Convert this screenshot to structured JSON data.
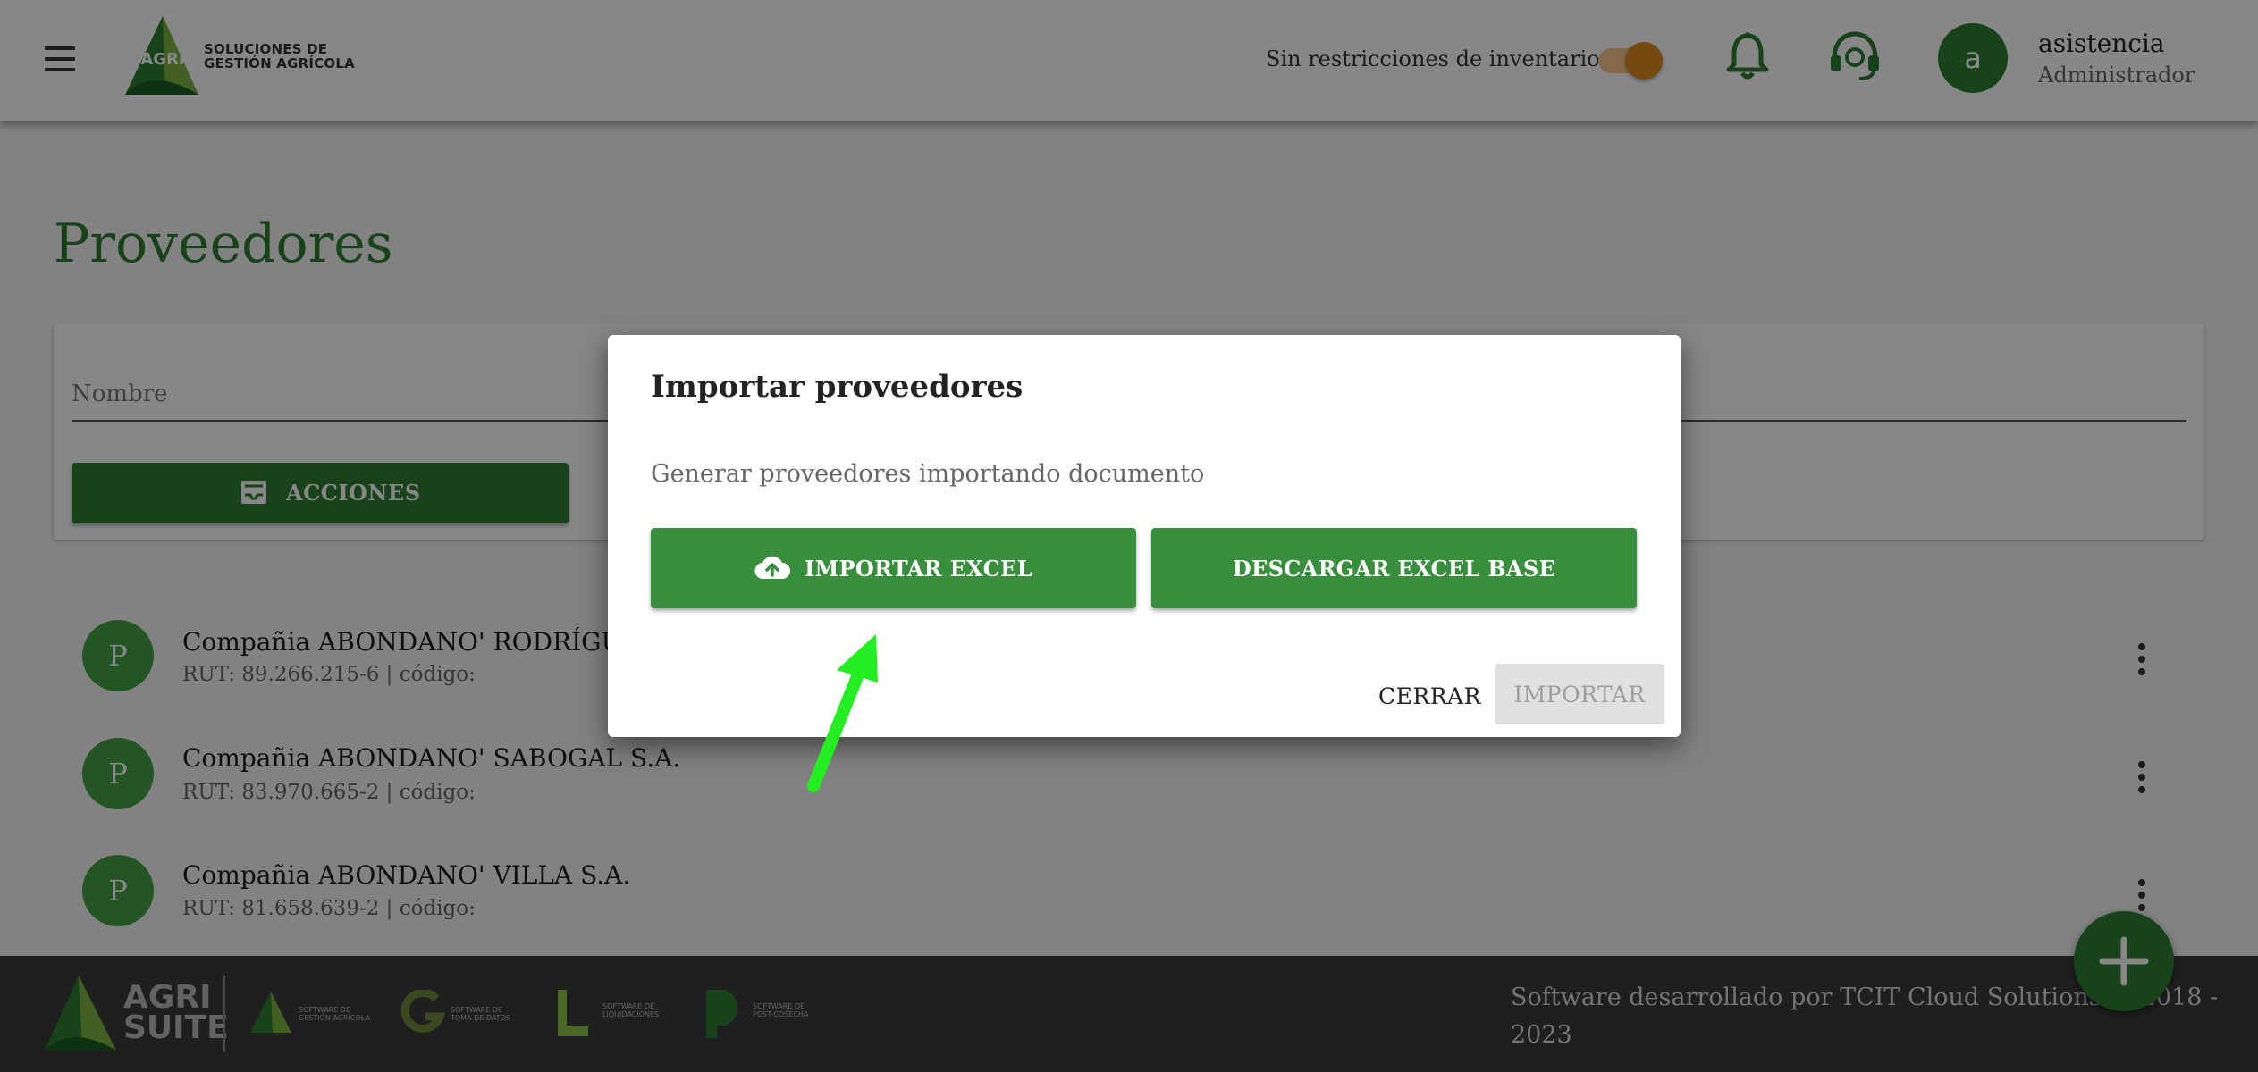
{
  "header": {
    "logo_text_line1": "SOLUCIONES DE",
    "logo_text_line2": "GESTIÓN AGRÍCOLA",
    "logo_badge": "AGRI",
    "inventory_toggle_label": "Sin restricciones de inventario",
    "inventory_toggle_on": true,
    "user_initial": "a",
    "user_name": "asistencia",
    "user_role": "Administrador"
  },
  "page": {
    "title": "Proveedores",
    "filter": {
      "name_label": "Nombre",
      "actions_label": "ACCIONES"
    },
    "providers": [
      {
        "initial": "P",
        "name": "Compañia ABONDANO' RODRÍGUEZ S.A.",
        "meta": "RUT: 89.266.215-6 | código:"
      },
      {
        "initial": "P",
        "name": "Compañia ABONDANO' SABOGAL S.A.",
        "meta": "RUT: 83.970.665-2 | código:"
      },
      {
        "initial": "P",
        "name": "Compañia ABONDANO' VILLA S.A.",
        "meta": "RUT: 81.658.639-2 | código:"
      }
    ]
  },
  "dialog": {
    "title": "Importar proveedores",
    "description": "Generar proveedores importando documento",
    "import_excel_label": "IMPORTAR EXCEL",
    "download_base_label": "DESCARGAR EXCEL BASE",
    "close_label": "CERRAR",
    "import_label": "IMPORTAR"
  },
  "footer": {
    "brand_line1": "AGRI",
    "brand_line2": "SUITE",
    "products": [
      {
        "badge": "AGRI",
        "caption": "SOFTWARE DE GESTIÓN AGRÍCOLA"
      },
      {
        "badge": "GRABIT",
        "caption": "SOFTWARE DE TOMA DE DATOS"
      },
      {
        "badge": "LIKIT",
        "caption": "SOFTWARE DE LIQUIDACIONES"
      },
      {
        "badge": "PAKIT",
        "caption": "SOFTWARE DE POST-COSECHA"
      }
    ],
    "credits": "Software desarrollado por TCIT Cloud Solutions © 2018 - 2023"
  },
  "colors": {
    "primary_green": "#2e7d32",
    "button_green": "#388e3c",
    "toggle_orange": "#e0891f",
    "annotation_arrow": "#22ee22"
  },
  "icons": [
    "menu-icon",
    "bell-icon",
    "headset-icon",
    "inbox-icon",
    "cloud-upload-icon",
    "more-vert-icon",
    "plus-icon"
  ]
}
